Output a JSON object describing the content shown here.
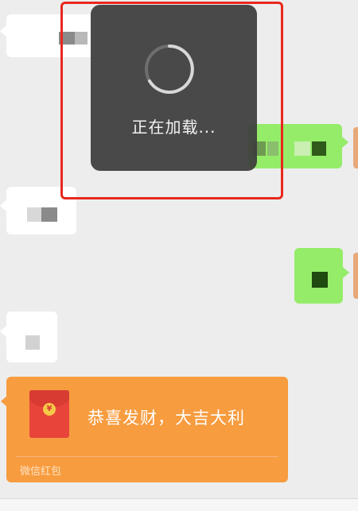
{
  "toast": {
    "text": "正在加载..."
  },
  "red_packet": {
    "title": "恭喜发财，大吉大利",
    "footer": "微信红包",
    "coin_symbol": "¥"
  },
  "colors": {
    "chat_background": "#ededed",
    "incoming_bubble": "#ffffff",
    "outgoing_bubble": "#95ec69",
    "red_packet": "#f79c3f",
    "toast_background": "#3c3c3c",
    "highlight_border": "#e8281e"
  },
  "icons": {
    "spinner": "loading-spinner-icon",
    "red_envelope": "red-envelope-icon"
  }
}
